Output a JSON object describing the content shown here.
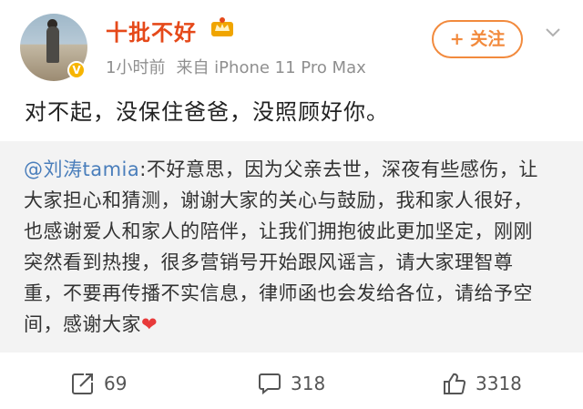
{
  "post": {
    "username": "十批不好",
    "time": "1小时前",
    "source": "来自 iPhone 11 Pro Max",
    "follow_label": "+ 关注",
    "text": "对不起，没保住爸爸，没照顾好你。"
  },
  "quote": {
    "mention": "@刘涛tamia",
    "body": ":不好意思，因为父亲去世，深夜有些感伤，让大家担心和猜测，谢谢大家的关心与鼓励，我和家人很好，也感谢爱人和家人的陪伴，让我们拥抱彼此更加坚定，刚刚突然看到热搜，很多营销号开始跟风谣言，请大家理智尊重，不要再传播不实信息，律师函也会发给各位，请给予空间，感谢大家",
    "heart": "❤"
  },
  "actions": {
    "repost_count": "69",
    "comment_count": "318",
    "like_count": "3318"
  },
  "colors": {
    "username": "#e5491a",
    "follow": "#f28a3d",
    "mention": "#4a7ebb",
    "quote_bg": "#f3f3f3"
  },
  "icons": [
    "avatar",
    "verified-badge-icon",
    "crown-badge-icon",
    "chevron-down-icon",
    "repost-icon",
    "comment-icon",
    "like-icon"
  ]
}
